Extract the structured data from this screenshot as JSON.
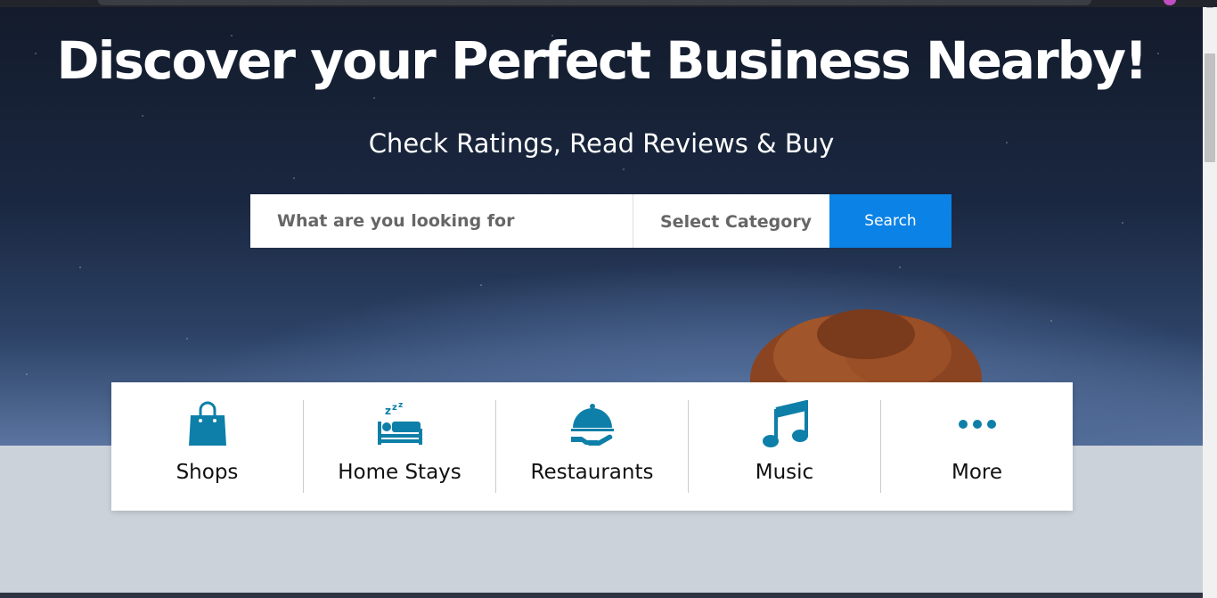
{
  "hero": {
    "headline": "Discover your Perfect Business Nearby!",
    "subline": "Check Ratings, Read Reviews & Buy"
  },
  "search": {
    "placeholder": "What are you looking for",
    "category_label": "Select Category",
    "button_label": "Search"
  },
  "categories": [
    {
      "label": "Shops",
      "icon": "shopping-bag-icon"
    },
    {
      "label": "Home Stays",
      "icon": "bed-sleep-icon"
    },
    {
      "label": "Restaurants",
      "icon": "serving-cloche-icon"
    },
    {
      "label": "Music",
      "icon": "music-note-icon"
    },
    {
      "label": "More",
      "icon": "ellipsis-icon"
    }
  ],
  "colors": {
    "accent": "#0b82e6",
    "icon": "#0e7fa8"
  }
}
